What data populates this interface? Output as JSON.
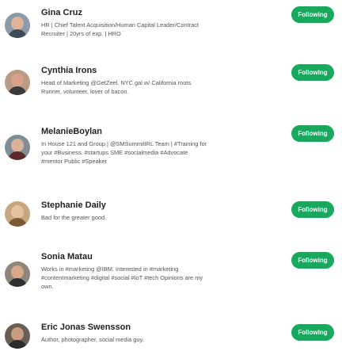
{
  "accent_color": "#18a85e",
  "follow_label": "Following",
  "users": [
    {
      "name": "Gina Cruz",
      "bio": "HR | Chief Talent Acquisition/Human Capital Leader/Contract Recruiter | 20yrs of exp. | HRO",
      "bio_lines": [
        "HR | Chief Talent Acquisition/Human Capital Leader/Contract",
        "Recruiter | 20yrs of exp. | HRO"
      ],
      "avatar_bg": "#8a9aa8",
      "avatar_face": "#e0b49a",
      "avatar_body": "#3d4a58"
    },
    {
      "name": "Cynthia Irons",
      "bio": "Head of Marketing @GetZeel. NYC gal w/ California roots. Runner, volunteer, lover of bacon.",
      "bio_lines": [
        "Head of Marketing @GetZeel. NYC gal w/ California roots.",
        "Runner, volunteer, lover of bacon."
      ],
      "avatar_bg": "#b99b86",
      "avatar_face": "#d7a08a",
      "avatar_body": "#3a3a3a"
    },
    {
      "name": "MelanieBoylan",
      "bio": "In House 121 and Group | @SMSummitIRL Team | #Training for your #Business. #startups SME #socialmedia #Advocate #mentor Public #Speaker",
      "bio_lines": [
        "In House 121 and Group | @SMSummitIRL Team | #Training for",
        "your #Business. #startups SME #socialmedia #Advocate",
        "#mentor Public #Speaker"
      ],
      "avatar_bg": "#7f8d96",
      "avatar_face": "#dab19a",
      "avatar_body": "#5a2a2a"
    },
    {
      "name": "Stephanie Daily",
      "bio": "Bad for the greater good.",
      "bio_lines": [
        "Bad for the greater good."
      ],
      "avatar_bg": "#c7a77f",
      "avatar_face": "#e6c2a2",
      "avatar_body": "#7a5a35"
    },
    {
      "name": "Sonia Matau",
      "bio": "Works in #marketing @IBM. Interested in #marketing #contentmarketing #digital #social #IoT #tech Opinions are my own.",
      "bio_lines": [
        "Works in #marketing @IBM. Interested in #marketing",
        "#contentmarketing #digital #social #IoT #tech Opinions are my",
        "own."
      ],
      "avatar_bg": "#8e8678",
      "avatar_face": "#d9a98c",
      "avatar_body": "#2f2f2f"
    },
    {
      "name": "Eric Jonas Swensson",
      "bio": "Author, photographer, social media guy.",
      "bio_lines": [
        "Author, photographer, social media guy."
      ],
      "avatar_bg": "#6a5e52",
      "avatar_face": "#c99c82",
      "avatar_body": "#2b2b2b"
    }
  ]
}
